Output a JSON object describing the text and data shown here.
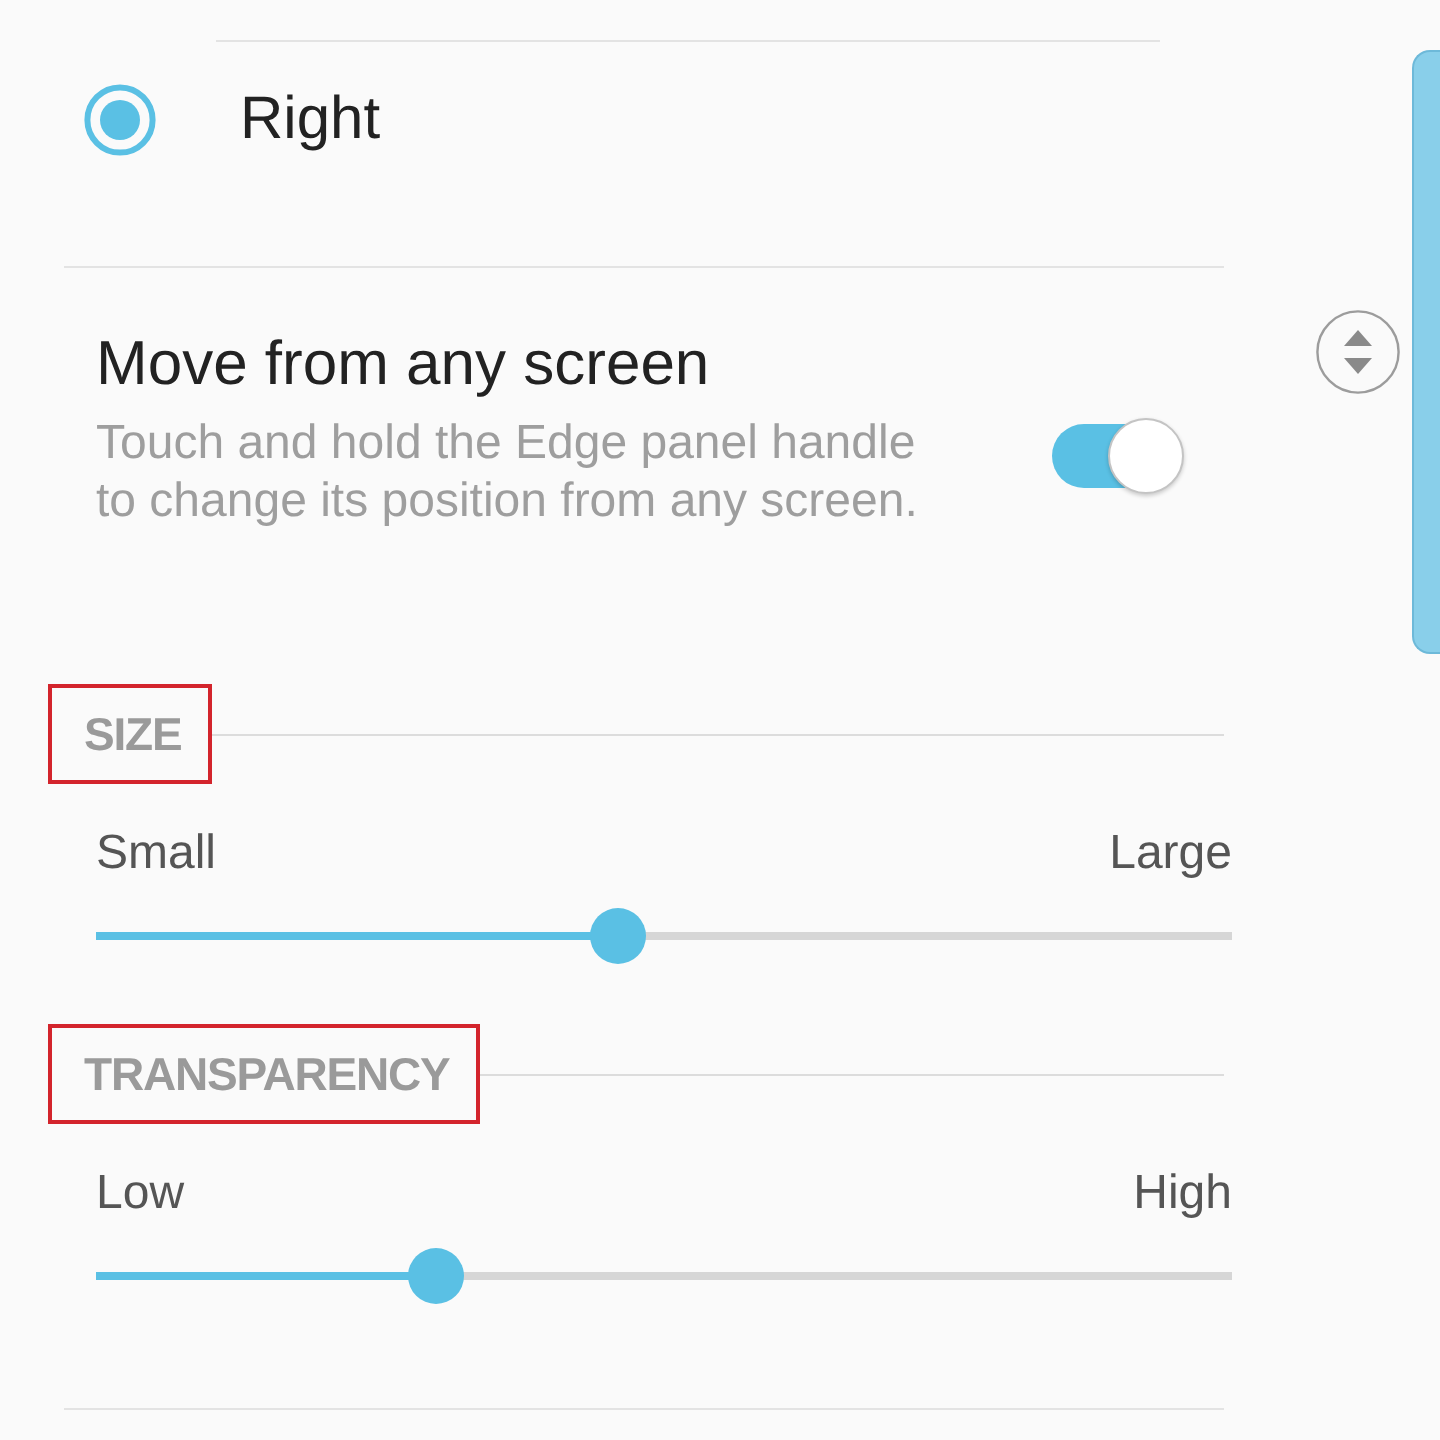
{
  "radio_option": {
    "label": "Right",
    "selected": true
  },
  "setting": {
    "title": "Move from any screen",
    "description": "Touch and hold the Edge panel handle to change its position from any screen.",
    "on": true
  },
  "sections": [
    {
      "header": "SIZE",
      "highlighted": true,
      "min_label": "Small",
      "max_label": "Large",
      "level": 0.46
    },
    {
      "header": "TRANSPARENCY",
      "highlighted": true,
      "min_label": "Low",
      "max_label": "High",
      "level": 0.3
    }
  ]
}
